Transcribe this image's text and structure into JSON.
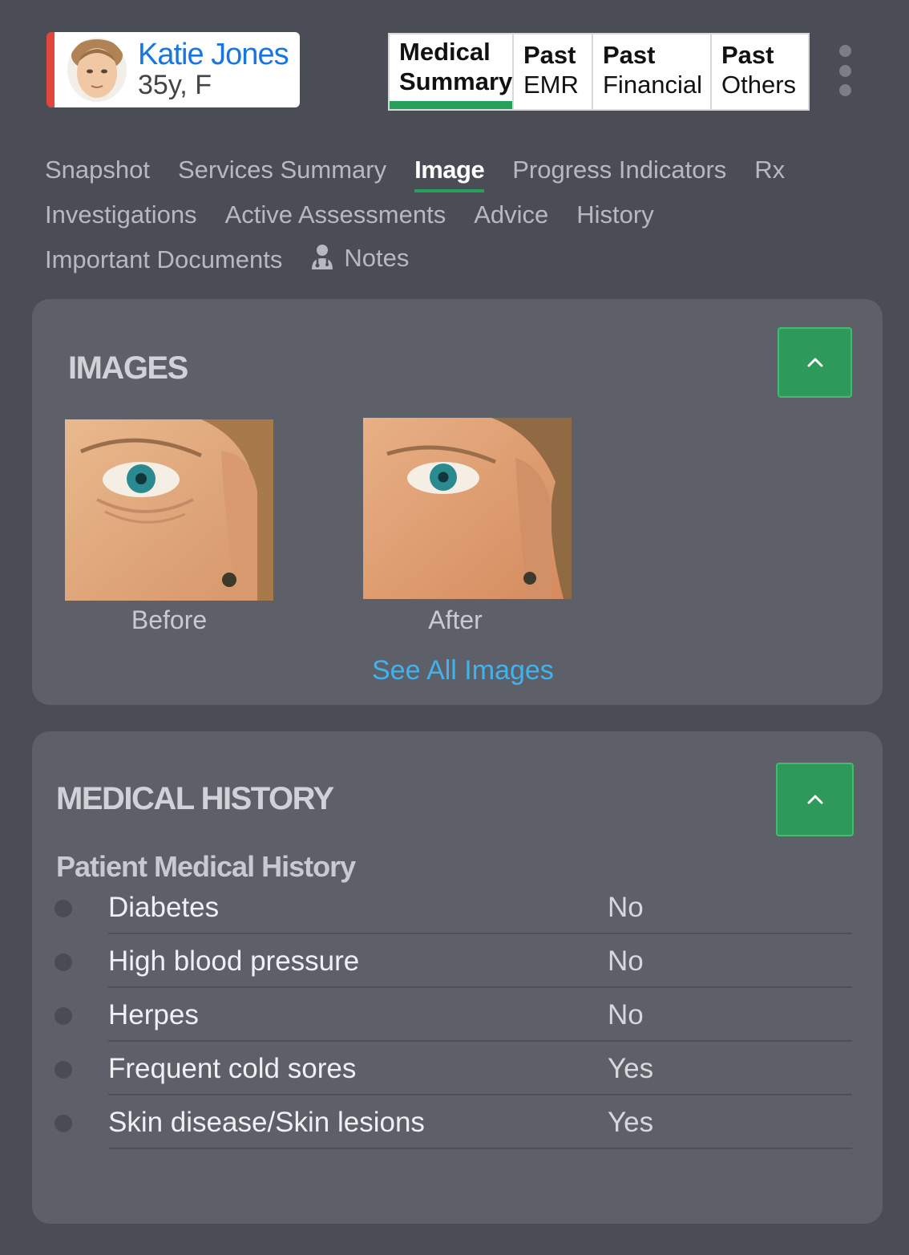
{
  "patient": {
    "name": "Katie Jones",
    "meta": "35y, F"
  },
  "record_tabs": [
    {
      "line1": "Medical",
      "line2": "Summary"
    },
    {
      "line1": "Past",
      "line2": "EMR"
    },
    {
      "line1": "Past",
      "line2": "Financial"
    },
    {
      "line1": "Past",
      "line2": "Others"
    }
  ],
  "nav": {
    "snapshot": "Snapshot",
    "services_summary": "Services Summary",
    "image": "Image",
    "progress_indicators": "Progress Indicators",
    "rx": "Rx",
    "investigations": "Investigations",
    "active_assessments": "Active Assessments",
    "advice": "Advice",
    "history": "History",
    "important_documents": "Important Documents",
    "notes": "Notes"
  },
  "images_panel": {
    "title": "IMAGES",
    "before_caption": "Before",
    "after_caption": "After",
    "see_all": "See All Images"
  },
  "history_panel": {
    "title": "MEDICAL HISTORY",
    "subtitle": "Patient Medical History",
    "rows": [
      {
        "label": "Diabetes",
        "value": "No"
      },
      {
        "label": "High blood pressure",
        "value": "No"
      },
      {
        "label": "Herpes",
        "value": "No"
      },
      {
        "label": "Frequent cold sores",
        "value": "Yes"
      },
      {
        "label": "Skin disease/Skin lesions",
        "value": "Yes"
      }
    ]
  },
  "colors": {
    "background": "#4b4d56",
    "panel": "#5e6069",
    "accent_green": "#2e9a5a",
    "link_blue": "#3fb3ee",
    "name_blue": "#1976e0",
    "alert_red": "#e0463b"
  },
  "icons": [
    "user-avatar",
    "more-vertical-icon",
    "doctor-icon",
    "chevron-up-icon"
  ]
}
